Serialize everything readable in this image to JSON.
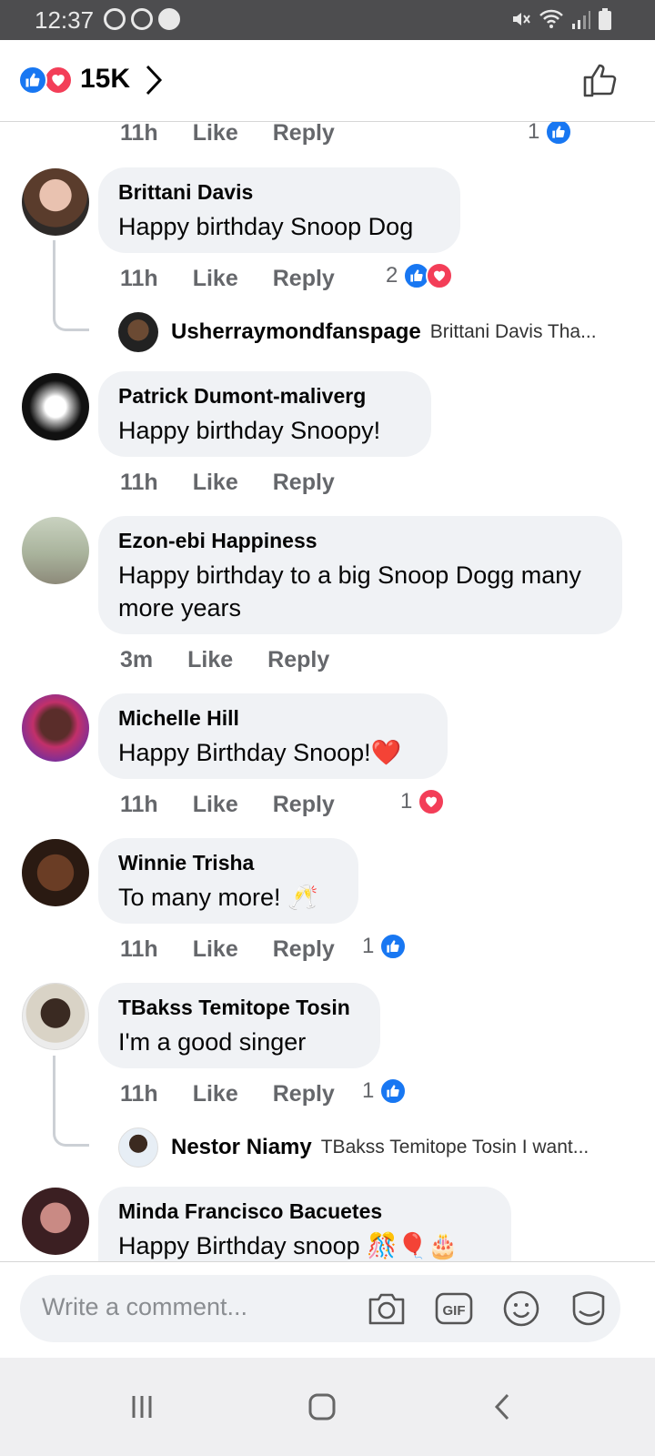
{
  "status_bar": {
    "time": "12:37"
  },
  "header": {
    "reaction_count": "15K"
  },
  "comments": [
    {
      "time": "11h",
      "like": "Like",
      "reply": "Reply",
      "reaction_count": "1"
    },
    {
      "name": "Brittani Davis",
      "text": "Happy birthday Snoop Dog",
      "time": "11h",
      "like": "Like",
      "reply": "Reply",
      "reaction_count": "2",
      "reply_preview": {
        "name": "Usherraymondfanspage",
        "text": "Brittani Davis Tha..."
      }
    },
    {
      "name": "Patrick Dumont-maliverg",
      "text": "Happy birthday Snoopy!",
      "time": "11h",
      "like": "Like",
      "reply": "Reply"
    },
    {
      "name": "Ezon-ebi Happiness",
      "text": "Happy birthday to a big Snoop Dogg many more years",
      "time": "3m",
      "like": "Like",
      "reply": "Reply"
    },
    {
      "name": "Michelle Hill",
      "text": "Happy Birthday Snoop!❤️",
      "time": "11h",
      "like": "Like",
      "reply": "Reply",
      "reaction_count": "1"
    },
    {
      "name": "Winnie Trisha",
      "text": "To many more! 🥂",
      "time": "11h",
      "like": "Like",
      "reply": "Reply",
      "reaction_count": "1"
    },
    {
      "name": "TBakss Temitope Tosin",
      "text": "I'm a good singer",
      "time": "11h",
      "like": "Like",
      "reply": "Reply",
      "reaction_count": "1",
      "reply_preview": {
        "name": "Nestor Niamy",
        "text": "TBakss Temitope Tosin I want..."
      }
    },
    {
      "name": "Minda Francisco Bacuetes",
      "text": "Happy Birthday snoop 🎊🎈🎂"
    }
  ],
  "composer": {
    "placeholder": "Write a comment..."
  },
  "colors": {
    "like_blue": "#1877f2",
    "love_red": "#f33e58",
    "bubble_gray": "#f0f2f5"
  }
}
